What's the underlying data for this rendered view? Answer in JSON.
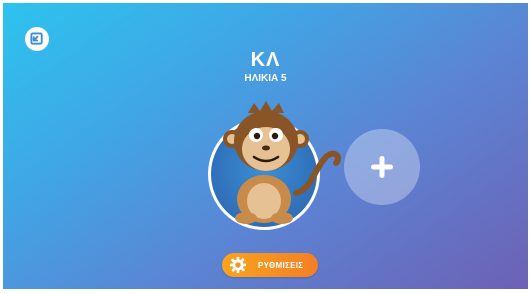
{
  "profile": {
    "name": "ΚΛ",
    "age_label": "ΗΛΙΚΙΑ 5",
    "avatar": "monkey"
  },
  "icons": {
    "exit": "exit-icon",
    "add": "plus-icon",
    "settings": "gear-icon"
  },
  "settings_button": {
    "label": "ΡΥΘΜΙΣΕΙΣ"
  },
  "colors": {
    "bg_start": "#2dc3ee",
    "bg_end": "#6d61b5",
    "accent": "#f8a41f",
    "avatar_bg": "#2f6fb8"
  }
}
